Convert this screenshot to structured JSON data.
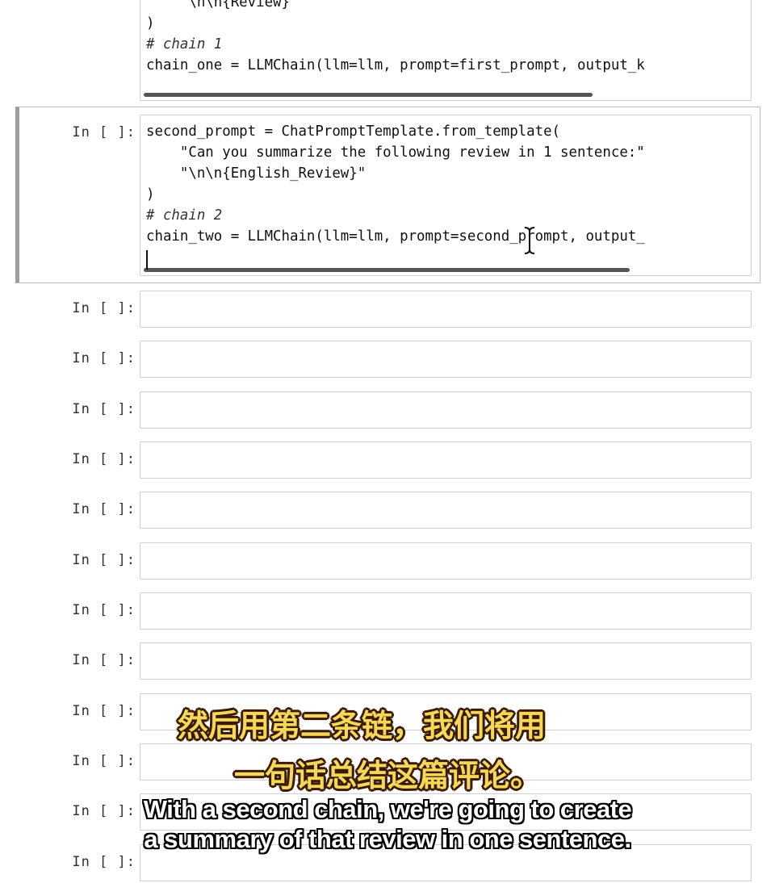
{
  "cells": {
    "first": {
      "lines": [
        "    \"\\n\\n{Review}\"",
        ")",
        "# chain 1",
        "chain_one = LLMChain(llm=llm, prompt=first_prompt, output_k"
      ]
    },
    "second": {
      "prompt": "In [ ]:",
      "lines": [
        "second_prompt = ChatPromptTemplate.from_template(",
        "    \"Can you summarize the following review in 1 sentence:\"",
        "    \"\\n\\n{English_Review}\"",
        ")",
        "# chain 2",
        "chain_two = LLMChain(llm=llm, prompt=second_prompt, output_"
      ]
    },
    "empty_prompt": "In [ ]:"
  },
  "subtitles": {
    "cn_line1": "然后用第二条链，我们将用",
    "cn_line2": "一句话总结这篇评论。",
    "en_line1": "With a second chain, we're going to create",
    "en_line2": "a summary of that review in one sentence."
  }
}
